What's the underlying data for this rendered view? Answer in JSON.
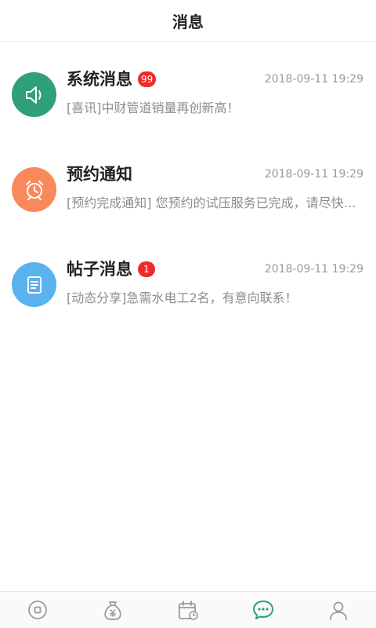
{
  "header": {
    "title": "消息"
  },
  "messages": [
    {
      "name": "系统消息",
      "badge": "99",
      "time": "2018-09-11 19:29",
      "preview": "[喜讯]中财管道销量再创新高！",
      "icon": "speaker-icon",
      "color": "#2fa07a"
    },
    {
      "name": "预约通知",
      "badge": "",
      "time": "2018-09-11 19:29",
      "preview": "[预约完成通知] 您预约的试压服务已完成，请尽快确认并评价本次服务",
      "icon": "alarm-clock-icon",
      "color": "#f8895b"
    },
    {
      "name": "帖子消息",
      "badge": "1",
      "time": "2018-09-11 19:29",
      "preview": "[动态分享]急需水电工2名，有意向联系！",
      "icon": "document-icon",
      "color": "#58b3ef"
    }
  ],
  "tabbar": {
    "tabs": [
      {
        "icon": "home-icon",
        "active": false
      },
      {
        "icon": "money-bag-icon",
        "active": false
      },
      {
        "icon": "calendar-icon",
        "active": false
      },
      {
        "icon": "chat-icon",
        "active": true
      },
      {
        "icon": "user-icon",
        "active": false
      }
    ],
    "active_color": "#2fa07a",
    "inactive_color": "#9a9a9a"
  }
}
